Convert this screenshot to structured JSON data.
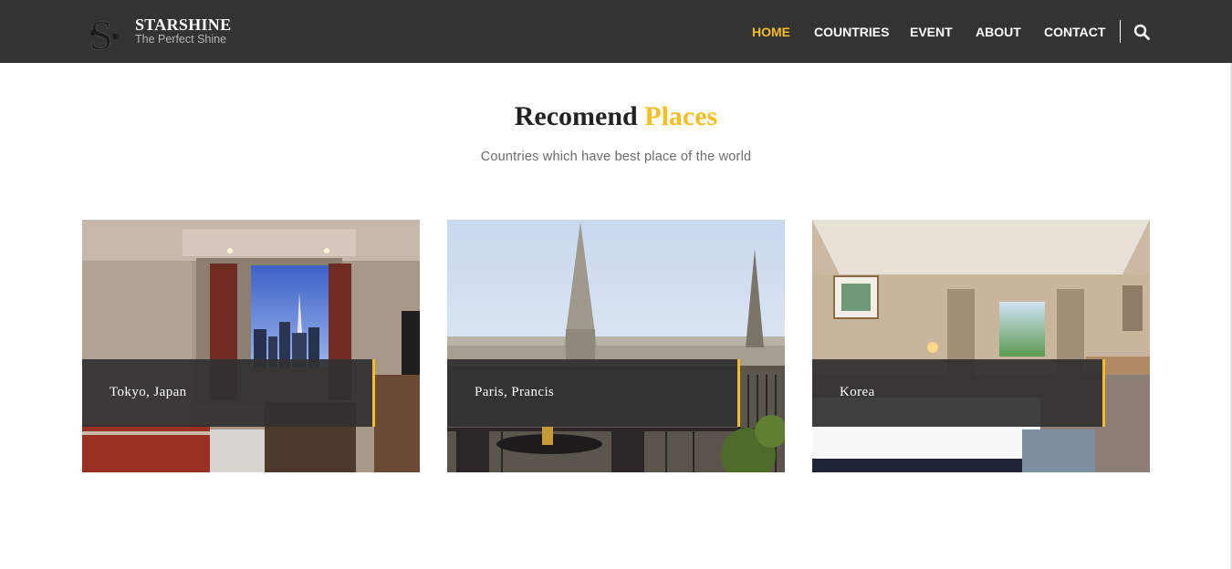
{
  "brand": {
    "name": "STARSHINE",
    "tagline": "The Perfect Shine"
  },
  "nav": {
    "items": [
      {
        "label": "HOME",
        "active": true
      },
      {
        "label": "COUNTRIES",
        "active": false
      },
      {
        "label": "EVENT",
        "active": false
      },
      {
        "label": "ABOUT",
        "active": false
      },
      {
        "label": "CONTACT",
        "active": false
      }
    ],
    "search_icon": "search-icon"
  },
  "section": {
    "title_main": "Recomend",
    "title_accent": "Places",
    "subtitle": "Countries which have best place of the world"
  },
  "cards": [
    {
      "caption": "Tokyo, Japan"
    },
    {
      "caption": "Paris, Prancis"
    },
    {
      "caption": "Korea"
    }
  ],
  "colors": {
    "nav_bg": "#333333",
    "accent": "#f5be24",
    "caption_bg": "#303030"
  }
}
